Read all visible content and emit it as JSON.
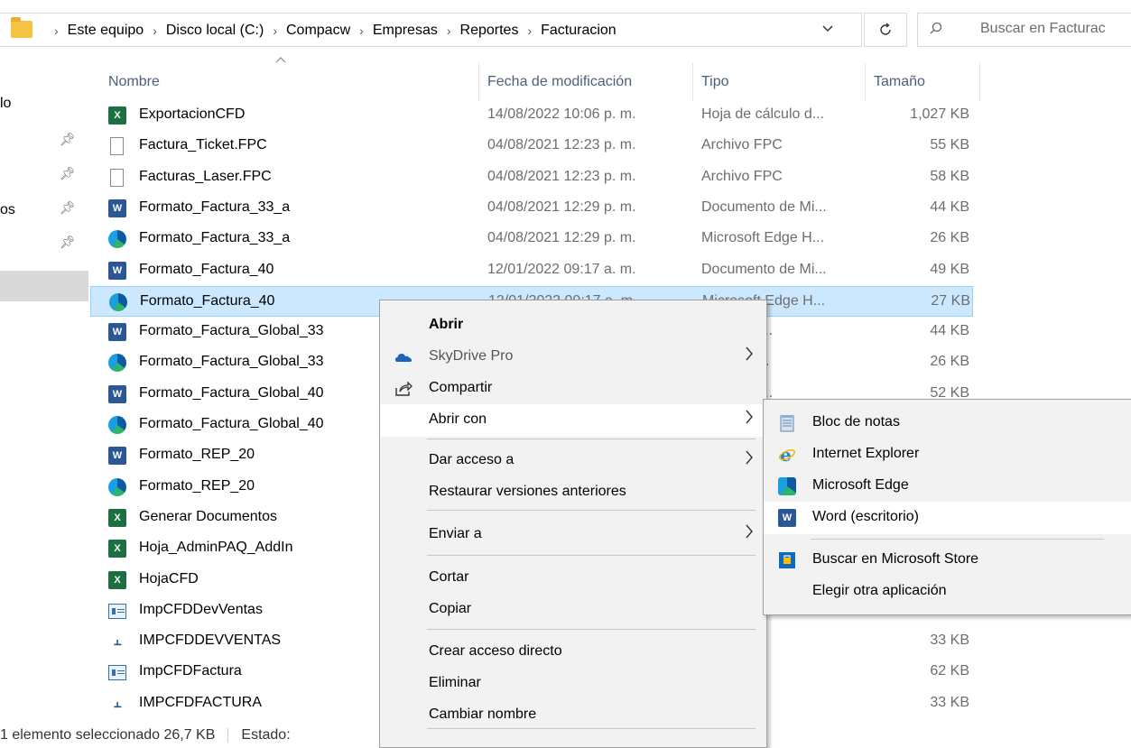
{
  "address": {
    "crumbs": [
      "Este equipo",
      "Disco local (C:)",
      "Compacw",
      "Empresas",
      "Reportes",
      "Facturacion"
    ],
    "sep": "›",
    "history_icon": "chevron-down-icon",
    "refresh_icon": "refresh-icon",
    "search_placeholder": "Buscar en Facturac"
  },
  "nav": {
    "items": [
      "lo",
      "os"
    ]
  },
  "columns": {
    "name": "Nombre",
    "date": "Fecha de modificación",
    "type": "Tipo",
    "size": "Tamaño"
  },
  "files": [
    {
      "name": "ExportacionCFD",
      "date": "14/08/2022 10:06 p. m.",
      "type": "Hoja de cálculo d...",
      "size": "1,027 KB",
      "icon": "excel-file-icon"
    },
    {
      "name": "Factura_Ticket.FPC",
      "date": "04/08/2021 12:23 p. m.",
      "type": "Archivo FPC",
      "size": "55 KB",
      "icon": "generic-file-icon"
    },
    {
      "name": "Facturas_Laser.FPC",
      "date": "04/08/2021 12:23 p. m.",
      "type": "Archivo FPC",
      "size": "58 KB",
      "icon": "generic-file-icon"
    },
    {
      "name": "Formato_Factura_33_a",
      "date": "04/08/2021 12:29 p. m.",
      "type": "Documento de Mi...",
      "size": "44 KB",
      "icon": "word-file-icon"
    },
    {
      "name": "Formato_Factura_33_a",
      "date": "04/08/2021 12:29 p. m.",
      "type": "Microsoft Edge H...",
      "size": "26 KB",
      "icon": "edge-file-icon"
    },
    {
      "name": "Formato_Factura_40",
      "date": "12/01/2022 09:17 a. m.",
      "type": "Documento de Mi...",
      "size": "49 KB",
      "icon": "word-file-icon"
    },
    {
      "name": "Formato_Factura_40",
      "date": "12/01/2022 09:17 a. m.",
      "type": "Microsoft Edge H...",
      "size": "27 KB",
      "icon": "edge-file-icon"
    },
    {
      "name": "Formato_Factura_Global_33",
      "date": "",
      "type": "nto de Mi...",
      "size": "44 KB",
      "icon": "word-file-icon"
    },
    {
      "name": "Formato_Factura_Global_33",
      "date": "",
      "type": "t Edge H...",
      "size": "26 KB",
      "icon": "edge-file-icon"
    },
    {
      "name": "Formato_Factura_Global_40",
      "date": "",
      "type": "nto de Mi...",
      "size": "52 KB",
      "icon": "word-file-icon"
    },
    {
      "name": "Formato_Factura_Global_40",
      "date": "",
      "type": "",
      "size": "",
      "icon": "edge-file-icon"
    },
    {
      "name": "Formato_REP_20",
      "date": "",
      "type": "",
      "size": "",
      "icon": "word-file-icon"
    },
    {
      "name": "Formato_REP_20",
      "date": "",
      "type": "",
      "size": "",
      "icon": "edge-file-icon"
    },
    {
      "name": "Generar Documentos",
      "date": "",
      "type": "",
      "size": "",
      "icon": "excel-file-icon"
    },
    {
      "name": "Hoja_AdminPAQ_AddIn",
      "date": "",
      "type": "",
      "size": "",
      "icon": "excel-addin-icon"
    },
    {
      "name": "HojaCFD",
      "date": "",
      "type": "",
      "size": "",
      "icon": "excel-file-icon"
    },
    {
      "name": "ImpCFDDevVentas",
      "date": "",
      "type": "",
      "size": "",
      "icon": "report-file-icon"
    },
    {
      "name": "IMPCFDDEVVENTAS",
      "date": "",
      "type": "TW",
      "size": "33 KB",
      "icon": "tw-file-icon"
    },
    {
      "name": "ImpCFDFactura",
      "date": "",
      "type": "PT",
      "size": "62 KB",
      "icon": "report-file-icon"
    },
    {
      "name": "IMPCFDFACTURA",
      "date": "",
      "type": "TW",
      "size": "33 KB",
      "icon": "tw-file-icon"
    }
  ],
  "selected_index": 6,
  "status": {
    "count": "1 elemento seleccionado  26,7 KB",
    "state": "Estado:"
  },
  "context_menu": {
    "items": [
      {
        "label": "Abrir",
        "bold": true
      },
      {
        "label": "SkyDrive Pro",
        "disabled": true,
        "submenu": true,
        "icon": "skydrive-icon"
      },
      {
        "label": "Compartir",
        "icon": "share-icon"
      },
      {
        "label": "Abrir con",
        "submenu": true,
        "hover": true
      },
      {
        "label": "Dar acceso a",
        "submenu": true
      },
      {
        "label": "Restaurar versiones anteriores"
      },
      {
        "label": "Enviar a",
        "submenu": true
      },
      {
        "label": "Cortar"
      },
      {
        "label": "Copiar"
      },
      {
        "label": "Crear acceso directo"
      },
      {
        "label": "Eliminar"
      },
      {
        "label": "Cambiar nombre"
      }
    ]
  },
  "open_with_menu": {
    "items": [
      {
        "label": "Bloc de notas",
        "icon": "notepad-icon"
      },
      {
        "label": "Internet Explorer",
        "icon": "internet-explorer-icon"
      },
      {
        "label": "Microsoft Edge",
        "icon": "edge-icon"
      },
      {
        "label": "Word (escritorio)",
        "icon": "word-icon",
        "hover": true
      },
      {
        "label": "Buscar en Microsoft Store",
        "icon": "store-icon"
      },
      {
        "label": "Elegir otra aplicación",
        "icon": ""
      }
    ]
  },
  "colors": {
    "selection": "#cce8ff",
    "header_text": "#4c607a",
    "menu_bg": "#f2f2f2"
  }
}
